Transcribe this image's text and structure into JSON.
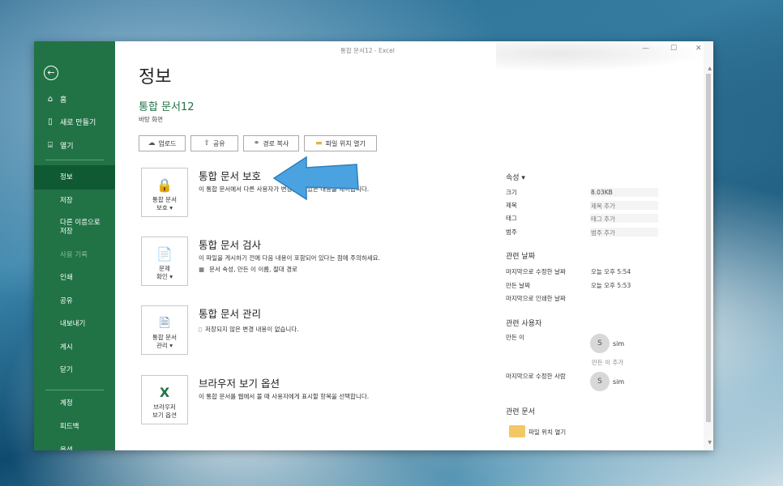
{
  "window": {
    "title": "통합 문서12  -  Excel",
    "controls": {
      "minimize": "—",
      "maximize": "☐",
      "close": "✕"
    }
  },
  "sidebar": {
    "back_icon": "arrow-left-circle-icon",
    "primary_items": [
      {
        "label": "홈",
        "icon": "home-icon"
      },
      {
        "label": "새로 만들기",
        "icon": "new-document-icon"
      },
      {
        "label": "열기",
        "icon": "open-folder-icon"
      }
    ],
    "secondary_items": [
      {
        "label": "정보",
        "active": true
      },
      {
        "label": "저장"
      },
      {
        "label": "다른 이름으로 저장"
      },
      {
        "label": "사용 기록",
        "disabled": true
      },
      {
        "label": "인쇄"
      },
      {
        "label": "공유"
      },
      {
        "label": "내보내기"
      },
      {
        "label": "게시"
      },
      {
        "label": "닫기"
      }
    ],
    "footer_items": [
      {
        "label": "계정"
      },
      {
        "label": "피드백"
      },
      {
        "label": "옵션"
      }
    ]
  },
  "main": {
    "heading": "정보",
    "doc_title": "통합 문서12",
    "doc_location": "바탕 화면",
    "actions": [
      {
        "label": "업로드",
        "icon": "cloud-upload-icon"
      },
      {
        "label": "공유",
        "icon": "share-icon"
      },
      {
        "label": "경로 복사",
        "icon": "link-icon"
      },
      {
        "label": "파일 위치 열기",
        "icon": "folder-icon"
      }
    ],
    "sections": [
      {
        "button_label": "통합 문서\n보호 ▾",
        "title": "통합 문서 보호",
        "desc": "이 통합 문서에서 다른 사용자가 변경할 수 있는 내용을 제어합니다.",
        "icon": "lock-key-icon"
      },
      {
        "button_label": "문제\n확인 ▾",
        "title": "통합 문서 검사",
        "desc": "이 파일을 게시하기 전에 다음 내용이 포함되어 있다는 점에 주의하세요.",
        "bullet": "문서 속성, 만든 이 이름, 절대 경로",
        "icon": "inspect-document-icon"
      },
      {
        "button_label": "통합 문서\n관리 ▾",
        "title": "통합 문서 관리",
        "desc": "저장되지 않은 변경 내용이 없습니다.",
        "icon": "manage-document-icon"
      },
      {
        "button_label": "브라우저\n보기 옵션",
        "title": "브라우저 보기 옵션",
        "desc": "이 통합 문서를 웹에서 볼 때 사용자에게 표시할 항목을 선택합니다.",
        "icon": "excel-browser-icon"
      }
    ]
  },
  "properties": {
    "heading": "속성 ▾",
    "items": [
      {
        "label": "크기",
        "value": "8.03KB",
        "filled": true
      },
      {
        "label": "제목",
        "value": "제목 추가"
      },
      {
        "label": "태그",
        "value": "태그 추가"
      },
      {
        "label": "범주",
        "value": "범주 추가"
      }
    ],
    "dates_heading": "관련 날짜",
    "dates": [
      {
        "label": "마지막으로 수정한 날짜",
        "value": "오늘 오후 5:54"
      },
      {
        "label": "만든 날짜",
        "value": "오늘 오후 5:53"
      },
      {
        "label": "마지막으로 인쇄한 날짜",
        "value": ""
      }
    ],
    "people_heading": "관련 사용자",
    "author_label": "만든 이",
    "author_initial": "S",
    "author_name": "sim",
    "add_author": "만든 이 추가",
    "modified_by_label": "마지막으로 수정한 사람",
    "modified_by_initial": "S",
    "modified_by_name": "sim",
    "docs_heading": "관련 문서",
    "open_location": "파일 위치 열기"
  },
  "annotation": {
    "arrow_color": "#4aa3e0"
  }
}
